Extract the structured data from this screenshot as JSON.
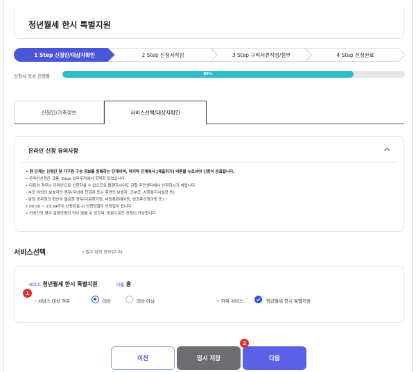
{
  "page_title": "청년월세 한시 특별지원",
  "steps": [
    {
      "label": "1 Step 신청인/대상자확인",
      "active": true
    },
    {
      "label": "2 Step 신청서작성",
      "active": false
    },
    {
      "label": "3 Step 구비서류작성/첨부",
      "active": false
    },
    {
      "label": "4 Step 신청완료",
      "active": false
    }
  ],
  "progress": {
    "label": "신청서 작성 진행률",
    "percent": 85,
    "percent_text": "85%",
    "color": "#2fbcc9"
  },
  "tabs": [
    {
      "label": "신청인/가족정보",
      "active": false
    },
    {
      "label": "서비스선택/대상자확인",
      "active": true
    }
  ],
  "notice": {
    "title": "온라인 신청 유의사항",
    "items": [
      "• 현 단계는 신청인 및 가구원 구성 정보를 등록하는 단계이며, 마지막 단계에서 [제출하기] 버튼을 누르셔야 신청이 완료됩니다.",
      "• 온라인신청은 크롬, Edge 브라우저에서 최적화 되었습니다.",
      "• 다음의 경우는 온라인으로 신청하실 수 없으므로 불편하시더도 관할 주민센터에서 신청하시기 바랍니다.",
      "  - 부모 이외의 보호자만 경우(자녀에 친권자 또는 후견인 보호자, 조부모, 사회복지시설장 등)",
      "  - 담당 공무원의 확인이 필요한 경우(다문화가정, 비등록장애아동, 방과후신청아동 등)",
      "• 00:00 ~ 23:59까지 신청완료 시 신청당일이 신청일이 됩니다.",
      "• 외국인의 경우 설명안중이 되지 않을 수 있으며, 방문으로만 신청이 가능합니다."
    ]
  },
  "service": {
    "section_title": "서비스선택",
    "required_note_dot": "•",
    "required_note": "필수 입력 정보입니다.",
    "service_label": "서비스",
    "service_value": "청년월세 한시 특별지원",
    "name_label": "이름",
    "name_value": "홍",
    "badge1": "1",
    "eligibility_label": "서비스 대상 여부",
    "option_yes": "대상",
    "option_no": "대상 아님",
    "sub_service_label": "하위 서비스",
    "sub_service_value": "청년월세 한시 특별지원"
  },
  "buttons": {
    "prev": "이전",
    "save": "임시 저장",
    "next": "다음",
    "badge2": "2"
  },
  "colors": {
    "primary": "#2d55d6",
    "accent": "#5a61e6",
    "step_active": "#4a56d8",
    "required": "#e0312e"
  }
}
